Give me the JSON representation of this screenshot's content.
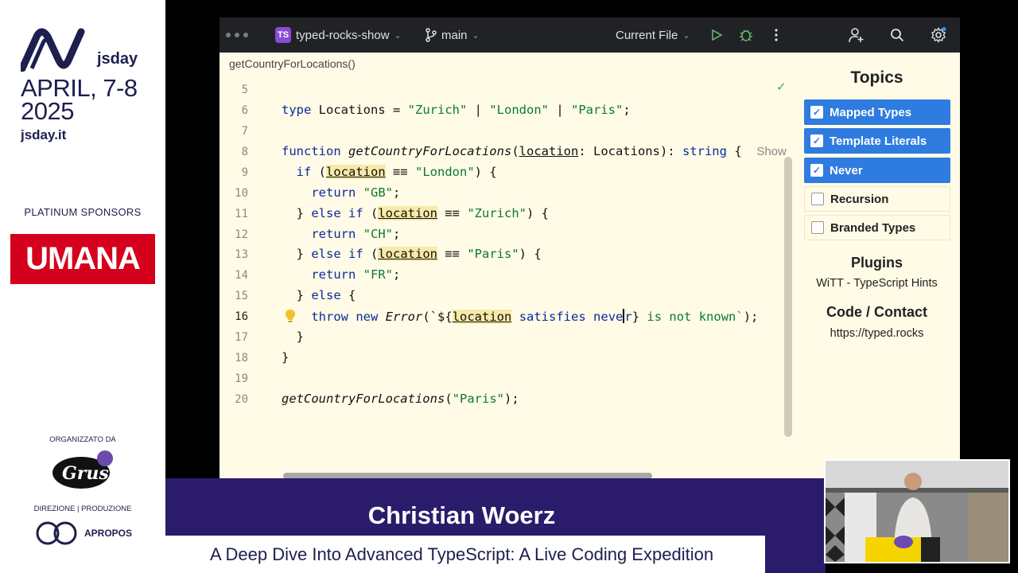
{
  "branding": {
    "logo_text": "jsday",
    "date": "APRIL, 7-8 2025",
    "site": "jsday.it",
    "sponsors_label": "PLATINUM SPONSORS",
    "sponsor_name": "UMANA",
    "organizer_label": "ORGANIZZATO DA",
    "organizer_name": "Grusp",
    "direction_label": "DIREZIONE | PRODUZIONE",
    "producer_name": "APROPOS"
  },
  "ide": {
    "project_badge": "TS",
    "project_name": "typed-rocks-show",
    "branch": "main",
    "run_config": "Current File",
    "breadcrumb": "getCountryForLocations()",
    "current_line": 16,
    "line_numbers": [
      "5",
      "6",
      "7",
      "8",
      "9",
      "10",
      "11",
      "12",
      "13",
      "14",
      "15",
      "16",
      "17",
      "18",
      "19",
      "20"
    ],
    "code": {
      "l6": {
        "kw": "type",
        "name": "Locations",
        "s1": "\"Zurich\"",
        "s2": "\"London\"",
        "s3": "\"Paris\""
      },
      "l8": {
        "kw": "function",
        "fn": "getCountryForLocations",
        "param": "location",
        "ptype": "Locations",
        "ret": "string",
        "hint": "Show"
      },
      "l9": {
        "kw": "if",
        "param": "location",
        "str": "\"London\""
      },
      "l10": {
        "kw": "return",
        "str": "\"GB\""
      },
      "l11": {
        "kw1": "else",
        "kw2": "if",
        "param": "location",
        "str": "\"Zurich\""
      },
      "l12": {
        "kw": "return",
        "str": "\"CH\""
      },
      "l13": {
        "kw1": "else",
        "kw2": "if",
        "param": "location",
        "str": "\"Paris\""
      },
      "l14": {
        "kw": "return",
        "str": "\"FR\""
      },
      "l15": {
        "kw": "else"
      },
      "l16": {
        "kw1": "throw",
        "kw2": "new",
        "cls": "Error",
        "param": "location",
        "satisfies": "satisfies",
        "never_a": "neve",
        "never_b": "r",
        "tail": " is not known`"
      },
      "l20": {
        "fn": "getCountryForLocations",
        "str": "\"Paris\""
      }
    }
  },
  "topics_panel": {
    "title": "Topics",
    "items": [
      {
        "label": "Mapped Types",
        "checked": true
      },
      {
        "label": "Template Literals",
        "checked": true
      },
      {
        "label": "Never",
        "checked": true
      },
      {
        "label": "Recursion",
        "checked": false
      },
      {
        "label": "Branded Types",
        "checked": false
      }
    ],
    "plugins_title": "Plugins",
    "plugins_text": "WiTT - TypeScript Hints",
    "contact_title": "Code / Contact",
    "contact_text": "https://typed.rocks",
    "check_glyph": "✓"
  },
  "lower_third": {
    "speaker": "Christian Woerz",
    "talk_title": "A Deep Dive Into Advanced TypeScript: A Live Coding Expedition"
  },
  "colors": {
    "brand_navy": "#1d1f4e",
    "accent_blue": "#2f7ce0",
    "band_purple": "#2b1b6b",
    "ide_bg": "#fffbe6",
    "titlebar": "#202226"
  }
}
